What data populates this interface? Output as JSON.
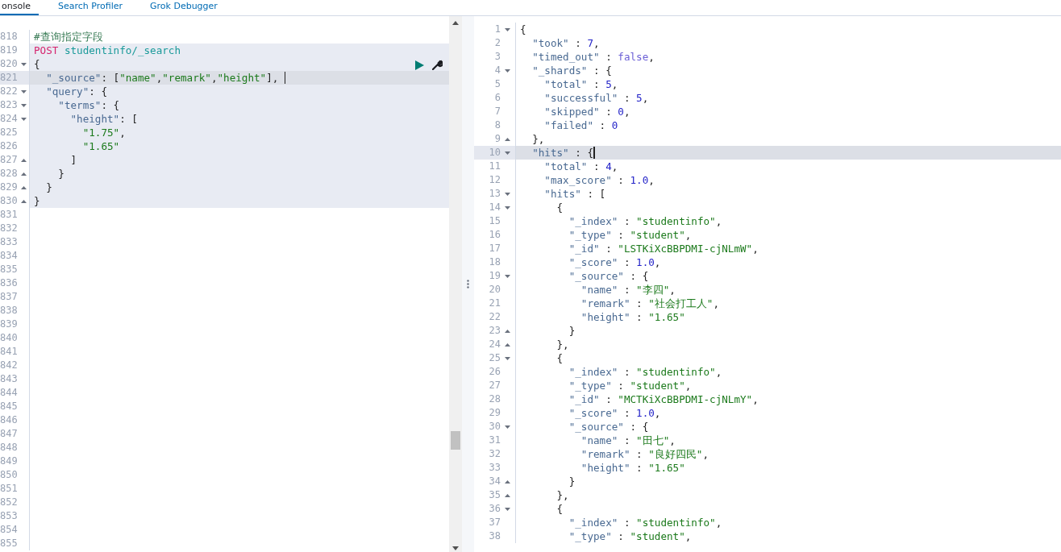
{
  "tabs": [
    {
      "label": "onsole",
      "selected": true
    },
    {
      "label": "Search Profiler",
      "selected": false
    },
    {
      "label": "Grok Debugger",
      "selected": false
    }
  ],
  "request_editor": {
    "lines": [
      {
        "number": "818",
        "tokens": [
          {
            "kind": "comment",
            "text": "#查询指定字段"
          }
        ]
      },
      {
        "number": "819",
        "highlighted": true,
        "tokens": [
          {
            "kind": "method",
            "text": "POST"
          },
          {
            "kind": "url",
            "text": " studentinfo/_search"
          }
        ]
      },
      {
        "number": "820",
        "fold_start": true,
        "highlighted": true,
        "tokens": [
          {
            "kind": "punct",
            "text": "{"
          }
        ]
      },
      {
        "number": "821",
        "highlighted": true,
        "current": true,
        "tokens": [
          {
            "kind": "key",
            "text": "  \"_source\""
          },
          {
            "kind": "punct",
            "text": ": ["
          },
          {
            "kind": "string",
            "text": "\"name\""
          },
          {
            "kind": "punct",
            "text": ","
          },
          {
            "kind": "string",
            "text": "\"remark\""
          },
          {
            "kind": "punct",
            "text": ","
          },
          {
            "kind": "string",
            "text": "\"height\""
          },
          {
            "kind": "punct",
            "text": "], "
          }
        ]
      },
      {
        "number": "822",
        "fold_start": true,
        "highlighted": true,
        "tokens": [
          {
            "kind": "key",
            "text": "  \"query\""
          },
          {
            "kind": "punct",
            "text": ": {"
          }
        ]
      },
      {
        "number": "823",
        "fold_start": true,
        "highlighted": true,
        "tokens": [
          {
            "kind": "key",
            "text": "    \"terms\""
          },
          {
            "kind": "punct",
            "text": ": {"
          }
        ]
      },
      {
        "number": "824",
        "fold_start": true,
        "highlighted": true,
        "tokens": [
          {
            "kind": "key",
            "text": "      \"height\""
          },
          {
            "kind": "punct",
            "text": ": ["
          }
        ]
      },
      {
        "number": "825",
        "highlighted": true,
        "tokens": [
          {
            "kind": "string",
            "text": "        \"1.75\""
          },
          {
            "kind": "punct",
            "text": ","
          }
        ]
      },
      {
        "number": "826",
        "highlighted": true,
        "tokens": [
          {
            "kind": "string",
            "text": "        \"1.65\""
          }
        ]
      },
      {
        "number": "827",
        "fold_end": true,
        "highlighted": true,
        "tokens": [
          {
            "kind": "punct",
            "text": "      ]"
          }
        ]
      },
      {
        "number": "828",
        "fold_end": true,
        "highlighted": true,
        "tokens": [
          {
            "kind": "punct",
            "text": "    }"
          }
        ]
      },
      {
        "number": "829",
        "fold_end": true,
        "highlighted": true,
        "tokens": [
          {
            "kind": "punct",
            "text": "  }"
          }
        ]
      },
      {
        "number": "830",
        "fold_end": true,
        "highlighted": true,
        "tokens": [
          {
            "kind": "punct",
            "text": "}"
          }
        ]
      },
      {
        "number": "831"
      },
      {
        "number": "832"
      },
      {
        "number": "833"
      },
      {
        "number": "834"
      },
      {
        "number": "835"
      },
      {
        "number": "836"
      },
      {
        "number": "837"
      },
      {
        "number": "838"
      },
      {
        "number": "839"
      },
      {
        "number": "840"
      },
      {
        "number": "841"
      },
      {
        "number": "842"
      },
      {
        "number": "843"
      },
      {
        "number": "844"
      },
      {
        "number": "845"
      },
      {
        "number": "846"
      },
      {
        "number": "847"
      },
      {
        "number": "848"
      },
      {
        "number": "849"
      },
      {
        "number": "850"
      },
      {
        "number": "851"
      },
      {
        "number": "852"
      },
      {
        "number": "853"
      },
      {
        "number": "854"
      },
      {
        "number": "855"
      }
    ]
  },
  "response_editor": {
    "lines": [
      {
        "number": "1",
        "fold_start": true,
        "tokens": [
          {
            "kind": "punct",
            "text": "{"
          }
        ]
      },
      {
        "number": "2",
        "tokens": [
          {
            "kind": "key",
            "text": "  \"took\""
          },
          {
            "kind": "punct",
            "text": " : "
          },
          {
            "kind": "number",
            "text": "7"
          },
          {
            "kind": "punct",
            "text": ","
          }
        ]
      },
      {
        "number": "3",
        "tokens": [
          {
            "kind": "key",
            "text": "  \"timed_out\""
          },
          {
            "kind": "punct",
            "text": " : "
          },
          {
            "kind": "boolean",
            "text": "false"
          },
          {
            "kind": "punct",
            "text": ","
          }
        ]
      },
      {
        "number": "4",
        "fold_start": true,
        "tokens": [
          {
            "kind": "key",
            "text": "  \"_shards\""
          },
          {
            "kind": "punct",
            "text": " : {"
          }
        ]
      },
      {
        "number": "5",
        "tokens": [
          {
            "kind": "key",
            "text": "    \"total\""
          },
          {
            "kind": "punct",
            "text": " : "
          },
          {
            "kind": "number",
            "text": "5"
          },
          {
            "kind": "punct",
            "text": ","
          }
        ]
      },
      {
        "number": "6",
        "tokens": [
          {
            "kind": "key",
            "text": "    \"successful\""
          },
          {
            "kind": "punct",
            "text": " : "
          },
          {
            "kind": "number",
            "text": "5"
          },
          {
            "kind": "punct",
            "text": ","
          }
        ]
      },
      {
        "number": "7",
        "tokens": [
          {
            "kind": "key",
            "text": "    \"skipped\""
          },
          {
            "kind": "punct",
            "text": " : "
          },
          {
            "kind": "number",
            "text": "0"
          },
          {
            "kind": "punct",
            "text": ","
          }
        ]
      },
      {
        "number": "8",
        "tokens": [
          {
            "kind": "key",
            "text": "    \"failed\""
          },
          {
            "kind": "punct",
            "text": " : "
          },
          {
            "kind": "number",
            "text": "0"
          }
        ]
      },
      {
        "number": "9",
        "fold_end": true,
        "tokens": [
          {
            "kind": "punct",
            "text": "  },"
          }
        ]
      },
      {
        "number": "10",
        "fold_start": true,
        "highlighted": true,
        "current": true,
        "tokens": [
          {
            "kind": "key",
            "text": "  \"hits\""
          },
          {
            "kind": "punct",
            "text": " : {"
          }
        ]
      },
      {
        "number": "11",
        "tokens": [
          {
            "kind": "key",
            "text": "    \"total\""
          },
          {
            "kind": "punct",
            "text": " : "
          },
          {
            "kind": "number",
            "text": "4"
          },
          {
            "kind": "punct",
            "text": ","
          }
        ]
      },
      {
        "number": "12",
        "tokens": [
          {
            "kind": "key",
            "text": "    \"max_score\""
          },
          {
            "kind": "punct",
            "text": " : "
          },
          {
            "kind": "number",
            "text": "1.0"
          },
          {
            "kind": "punct",
            "text": ","
          }
        ]
      },
      {
        "number": "13",
        "fold_start": true,
        "tokens": [
          {
            "kind": "key",
            "text": "    \"hits\""
          },
          {
            "kind": "punct",
            "text": " : ["
          }
        ]
      },
      {
        "number": "14",
        "fold_start": true,
        "tokens": [
          {
            "kind": "punct",
            "text": "      {"
          }
        ]
      },
      {
        "number": "15",
        "tokens": [
          {
            "kind": "key",
            "text": "        \"_index\""
          },
          {
            "kind": "punct",
            "text": " : "
          },
          {
            "kind": "string",
            "text": "\"studentinfo\""
          },
          {
            "kind": "punct",
            "text": ","
          }
        ]
      },
      {
        "number": "16",
        "tokens": [
          {
            "kind": "key",
            "text": "        \"_type\""
          },
          {
            "kind": "punct",
            "text": " : "
          },
          {
            "kind": "string",
            "text": "\"student\""
          },
          {
            "kind": "punct",
            "text": ","
          }
        ]
      },
      {
        "number": "17",
        "tokens": [
          {
            "kind": "key",
            "text": "        \"_id\""
          },
          {
            "kind": "punct",
            "text": " : "
          },
          {
            "kind": "string",
            "text": "\"LSTKiXcBBPDMI-cjNLmW\""
          },
          {
            "kind": "punct",
            "text": ","
          }
        ]
      },
      {
        "number": "18",
        "tokens": [
          {
            "kind": "key",
            "text": "        \"_score\""
          },
          {
            "kind": "punct",
            "text": " : "
          },
          {
            "kind": "number",
            "text": "1.0"
          },
          {
            "kind": "punct",
            "text": ","
          }
        ]
      },
      {
        "number": "19",
        "fold_start": true,
        "tokens": [
          {
            "kind": "key",
            "text": "        \"_source\""
          },
          {
            "kind": "punct",
            "text": " : {"
          }
        ]
      },
      {
        "number": "20",
        "tokens": [
          {
            "kind": "key",
            "text": "          \"name\""
          },
          {
            "kind": "punct",
            "text": " : "
          },
          {
            "kind": "string",
            "text": "\"李四\""
          },
          {
            "kind": "punct",
            "text": ","
          }
        ]
      },
      {
        "number": "21",
        "tokens": [
          {
            "kind": "key",
            "text": "          \"remark\""
          },
          {
            "kind": "punct",
            "text": " : "
          },
          {
            "kind": "string",
            "text": "\"社会打工人\""
          },
          {
            "kind": "punct",
            "text": ","
          }
        ]
      },
      {
        "number": "22",
        "tokens": [
          {
            "kind": "key",
            "text": "          \"height\""
          },
          {
            "kind": "punct",
            "text": " : "
          },
          {
            "kind": "string",
            "text": "\"1.65\""
          }
        ]
      },
      {
        "number": "23",
        "fold_end": true,
        "tokens": [
          {
            "kind": "punct",
            "text": "        }"
          }
        ]
      },
      {
        "number": "24",
        "fold_end": true,
        "tokens": [
          {
            "kind": "punct",
            "text": "      },"
          }
        ]
      },
      {
        "number": "25",
        "fold_start": true,
        "tokens": [
          {
            "kind": "punct",
            "text": "      {"
          }
        ]
      },
      {
        "number": "26",
        "tokens": [
          {
            "kind": "key",
            "text": "        \"_index\""
          },
          {
            "kind": "punct",
            "text": " : "
          },
          {
            "kind": "string",
            "text": "\"studentinfo\""
          },
          {
            "kind": "punct",
            "text": ","
          }
        ]
      },
      {
        "number": "27",
        "tokens": [
          {
            "kind": "key",
            "text": "        \"_type\""
          },
          {
            "kind": "punct",
            "text": " : "
          },
          {
            "kind": "string",
            "text": "\"student\""
          },
          {
            "kind": "punct",
            "text": ","
          }
        ]
      },
      {
        "number": "28",
        "tokens": [
          {
            "kind": "key",
            "text": "        \"_id\""
          },
          {
            "kind": "punct",
            "text": " : "
          },
          {
            "kind": "string",
            "text": "\"MCTKiXcBBPDMI-cjNLmY\""
          },
          {
            "kind": "punct",
            "text": ","
          }
        ]
      },
      {
        "number": "29",
        "tokens": [
          {
            "kind": "key",
            "text": "        \"_score\""
          },
          {
            "kind": "punct",
            "text": " : "
          },
          {
            "kind": "number",
            "text": "1.0"
          },
          {
            "kind": "punct",
            "text": ","
          }
        ]
      },
      {
        "number": "30",
        "fold_start": true,
        "tokens": [
          {
            "kind": "key",
            "text": "        \"_source\""
          },
          {
            "kind": "punct",
            "text": " : {"
          }
        ]
      },
      {
        "number": "31",
        "tokens": [
          {
            "kind": "key",
            "text": "          \"name\""
          },
          {
            "kind": "punct",
            "text": " : "
          },
          {
            "kind": "string",
            "text": "\"田七\""
          },
          {
            "kind": "punct",
            "text": ","
          }
        ]
      },
      {
        "number": "32",
        "tokens": [
          {
            "kind": "key",
            "text": "          \"remark\""
          },
          {
            "kind": "punct",
            "text": " : "
          },
          {
            "kind": "string",
            "text": "\"良好四民\""
          },
          {
            "kind": "punct",
            "text": ","
          }
        ]
      },
      {
        "number": "33",
        "tokens": [
          {
            "kind": "key",
            "text": "          \"height\""
          },
          {
            "kind": "punct",
            "text": " : "
          },
          {
            "kind": "string",
            "text": "\"1.65\""
          }
        ]
      },
      {
        "number": "34",
        "fold_end": true,
        "tokens": [
          {
            "kind": "punct",
            "text": "        }"
          }
        ]
      },
      {
        "number": "35",
        "fold_end": true,
        "tokens": [
          {
            "kind": "punct",
            "text": "      },"
          }
        ]
      },
      {
        "number": "36",
        "fold_start": true,
        "tokens": [
          {
            "kind": "punct",
            "text": "      {"
          }
        ]
      },
      {
        "number": "37",
        "tokens": [
          {
            "kind": "key",
            "text": "        \"_index\""
          },
          {
            "kind": "punct",
            "text": " : "
          },
          {
            "kind": "string",
            "text": "\"studentinfo\""
          },
          {
            "kind": "punct",
            "text": ","
          }
        ]
      },
      {
        "number": "38",
        "tokens": [
          {
            "kind": "key",
            "text": "        \"_type\""
          },
          {
            "kind": "punct",
            "text": " : "
          },
          {
            "kind": "string",
            "text": "\"student\""
          },
          {
            "kind": "punct",
            "text": ","
          }
        ]
      }
    ]
  }
}
